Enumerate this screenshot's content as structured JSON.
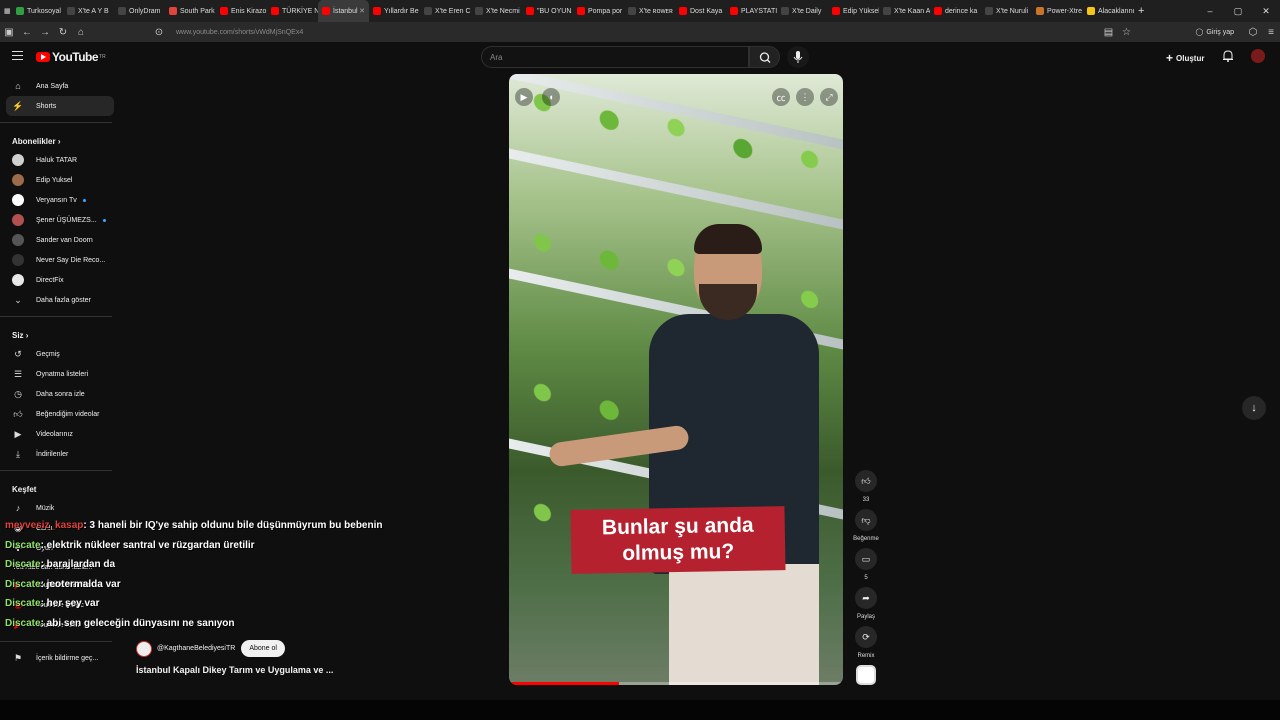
{
  "browser": {
    "tabs": [
      {
        "label": "Turkosoyal",
        "color": "#2ea043"
      },
      {
        "label": "X'te A Y B",
        "color": "#444"
      },
      {
        "label": "OnlyDram",
        "color": "#444"
      },
      {
        "label": "South Park",
        "color": "#e0443b"
      },
      {
        "label": "Enis Kirazo",
        "color": "#ff0000"
      },
      {
        "label": "TÜRKİYE N",
        "color": "#ff0000"
      },
      {
        "label": "İstanbul",
        "color": "#ff0000",
        "active": true
      },
      {
        "label": "Yıllardır Be",
        "color": "#ff0000"
      },
      {
        "label": "X'te Eren C",
        "color": "#444"
      },
      {
        "label": "X'te Necmi",
        "color": "#444"
      },
      {
        "label": "\"BU OYUN",
        "color": "#ff0000"
      },
      {
        "label": "Pompa por",
        "color": "#ff0000"
      },
      {
        "label": "X'te ʀᴏᴡᴇʀ",
        "color": "#444"
      },
      {
        "label": "Dost Kaya",
        "color": "#ff0000"
      },
      {
        "label": "PLAYSTATI",
        "color": "#ff0000"
      },
      {
        "label": "X'te Daily",
        "color": "#444"
      },
      {
        "label": "Edip Yüksel",
        "color": "#ff0000"
      },
      {
        "label": "X'te Kaan A",
        "color": "#444"
      },
      {
        "label": "derince ka",
        "color": "#ff0000"
      },
      {
        "label": "X'te Nuruli",
        "color": "#444"
      },
      {
        "label": "Power-Xtre",
        "color": "#c9732b"
      },
      {
        "label": "Alacaklarını",
        "color": "#f5c518"
      }
    ],
    "url": "www.youtube.com/shorts/vWdMjSnQEx4",
    "signin": "Giriş yap"
  },
  "header": {
    "logo": "YouTube",
    "logo_sup": "TR",
    "search_placeholder": "Ara",
    "create_label": "Oluştur"
  },
  "sidebar": {
    "main": [
      {
        "label": "Ana Sayfa",
        "icon": "home-icon"
      },
      {
        "label": "Shorts",
        "icon": "shorts-icon"
      }
    ],
    "subs_title": "Abonelikler",
    "subs": [
      {
        "label": "Haluk TATAR",
        "color": "#d0d0d0"
      },
      {
        "label": "Edip Yuksel",
        "color": "#9c6b4c"
      },
      {
        "label": "Veryansın Tv",
        "color": "#ffffff"
      },
      {
        "label": "Şener ÜŞÜMEZS...",
        "color": "#b05050"
      },
      {
        "label": "Sander van Doorn",
        "color": "#555555"
      },
      {
        "label": "Never Say Die Reco...",
        "color": "#333333"
      },
      {
        "label": "DirectFix",
        "color": "#e8e8e8"
      }
    ],
    "more_label": "Daha fazla göster",
    "you_title": "Siz",
    "you": [
      {
        "label": "Geçmiş",
        "icon": "history-icon"
      },
      {
        "label": "Oynatma listeleri",
        "icon": "playlist-icon"
      },
      {
        "label": "Daha sonra izle",
        "icon": "clock-icon"
      },
      {
        "label": "Beğendiğim videolar",
        "icon": "like-icon"
      },
      {
        "label": "Videolarınız",
        "icon": "video-icon"
      },
      {
        "label": "İndirilenler",
        "icon": "download-icon"
      }
    ],
    "explore_title": "Keşfet",
    "explore": [
      {
        "label": "Müzik",
        "icon": "music-icon"
      },
      {
        "label": "Canlı",
        "icon": "live-icon"
      },
      {
        "label": "Oyun",
        "icon": "game-icon"
      }
    ],
    "more_from_title": "YouTube'dan daha fazla...",
    "more_from": [
      {
        "label": "YouTube Premium",
        "icon": "youtube-premium-icon"
      },
      {
        "label": "YouTube Music",
        "icon": "youtube-music-icon"
      },
      {
        "label": "YouTube Kids",
        "icon": "youtube-kids-icon"
      }
    ],
    "report": "İçerik bildirme geç..."
  },
  "video": {
    "caption_line1": "Bunlar şu anda",
    "caption_line2": "olmuş mu?",
    "progress": 0.33
  },
  "actions": {
    "likes": "33",
    "dislike_label": "Beğenme",
    "comments": "5",
    "share_label": "Paylaş",
    "remix_label": "Remix"
  },
  "meta": {
    "channel": "@KagthaneBelediyesiTR",
    "subscribe": "Abone ol",
    "title": "İstanbul Kapalı Dikey Tarım ve Uygulama ve ..."
  },
  "chat": [
    {
      "user": "meyvesiz_kasap",
      "color": "#e0413a",
      "msg": ": 3 haneli bir IQ'ye sahip oldunu bile düşünmüyrum bu bebenin"
    },
    {
      "user": "Discate",
      "color": "#8fe36a",
      "msg": ": elektrik nükleer santral ve rüzgardan üretilir"
    },
    {
      "user": "Discate",
      "color": "#8fe36a",
      "msg": ": barajlardan da"
    },
    {
      "user": "Discate",
      "color": "#8fe36a",
      "msg": ": jeotermalda var"
    },
    {
      "user": "Discate",
      "color": "#8fe36a",
      "msg": ": her şey var"
    },
    {
      "user": "Discate",
      "color": "#8fe36a",
      "msg": ": abi sen geleceğin dünyasını ne sanıyon"
    }
  ]
}
